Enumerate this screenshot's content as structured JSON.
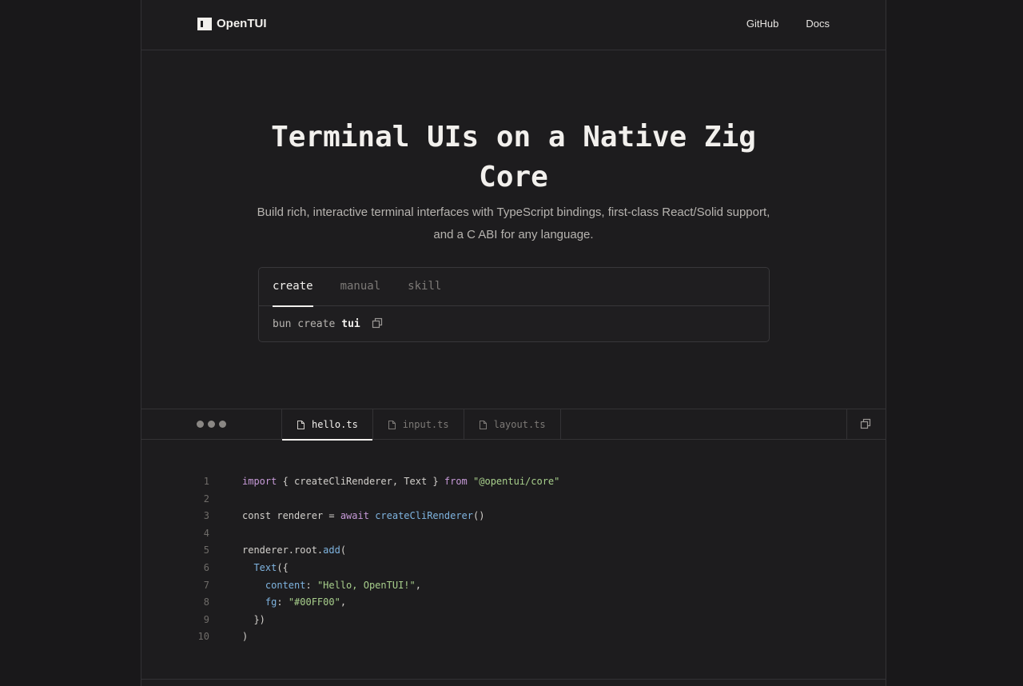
{
  "header": {
    "brand": "OpenTUI",
    "nav": [
      {
        "label": "GitHub"
      },
      {
        "label": "Docs"
      }
    ]
  },
  "hero": {
    "title": "Terminal UIs on a Native Zig Core",
    "subtitle": "Build rich, interactive terminal interfaces with TypeScript bindings, first-class React/Solid support, and a C ABI for any language."
  },
  "install": {
    "tabs": [
      {
        "label": "create",
        "active": true
      },
      {
        "label": "manual",
        "active": false
      },
      {
        "label": "skill",
        "active": false
      }
    ],
    "command_prefix": "bun create",
    "command_arg": "tui"
  },
  "editor": {
    "tabs": [
      {
        "label": "hello.ts",
        "active": true
      },
      {
        "label": "input.ts",
        "active": false
      },
      {
        "label": "layout.ts",
        "active": false
      }
    ],
    "lines": [
      {
        "n": "1",
        "tokens": [
          [
            "kw",
            "import"
          ],
          [
            "plain",
            " { createCliRenderer, Text } "
          ],
          [
            "kw",
            "from"
          ],
          [
            "plain",
            " "
          ],
          [
            "str",
            "\"@opentui/core\""
          ]
        ]
      },
      {
        "n": "2",
        "tokens": []
      },
      {
        "n": "3",
        "tokens": [
          [
            "plain",
            "const renderer = "
          ],
          [
            "kw",
            "await"
          ],
          [
            "plain",
            " "
          ],
          [
            "fn",
            "createCliRenderer"
          ],
          [
            "plain",
            "()"
          ]
        ]
      },
      {
        "n": "4",
        "tokens": []
      },
      {
        "n": "5",
        "tokens": [
          [
            "plain",
            "renderer.root."
          ],
          [
            "fn",
            "add"
          ],
          [
            "plain",
            "("
          ]
        ]
      },
      {
        "n": "6",
        "tokens": [
          [
            "plain",
            "  "
          ],
          [
            "fn",
            "Text"
          ],
          [
            "plain",
            "({"
          ]
        ]
      },
      {
        "n": "7",
        "tokens": [
          [
            "plain",
            "    "
          ],
          [
            "prop",
            "content"
          ],
          [
            "plain",
            ": "
          ],
          [
            "str",
            "\"Hello, OpenTUI!\""
          ],
          [
            "plain",
            ","
          ]
        ]
      },
      {
        "n": "8",
        "tokens": [
          [
            "plain",
            "    "
          ],
          [
            "prop",
            "fg"
          ],
          [
            "plain",
            ": "
          ],
          [
            "str",
            "\"#00FF00\""
          ],
          [
            "plain",
            ","
          ]
        ]
      },
      {
        "n": "9",
        "tokens": [
          [
            "plain",
            "  })"
          ]
        ]
      },
      {
        "n": "10",
        "tokens": [
          [
            "plain",
            ")"
          ]
        ]
      }
    ]
  },
  "icons": {
    "copy": "copy-icon",
    "file": "file-icon"
  },
  "colors": {
    "background": "#19181a",
    "panel": "#1d1c1e",
    "keyword": "#c79ad8",
    "function": "#7fb4e0",
    "string": "#a8cf8c"
  }
}
